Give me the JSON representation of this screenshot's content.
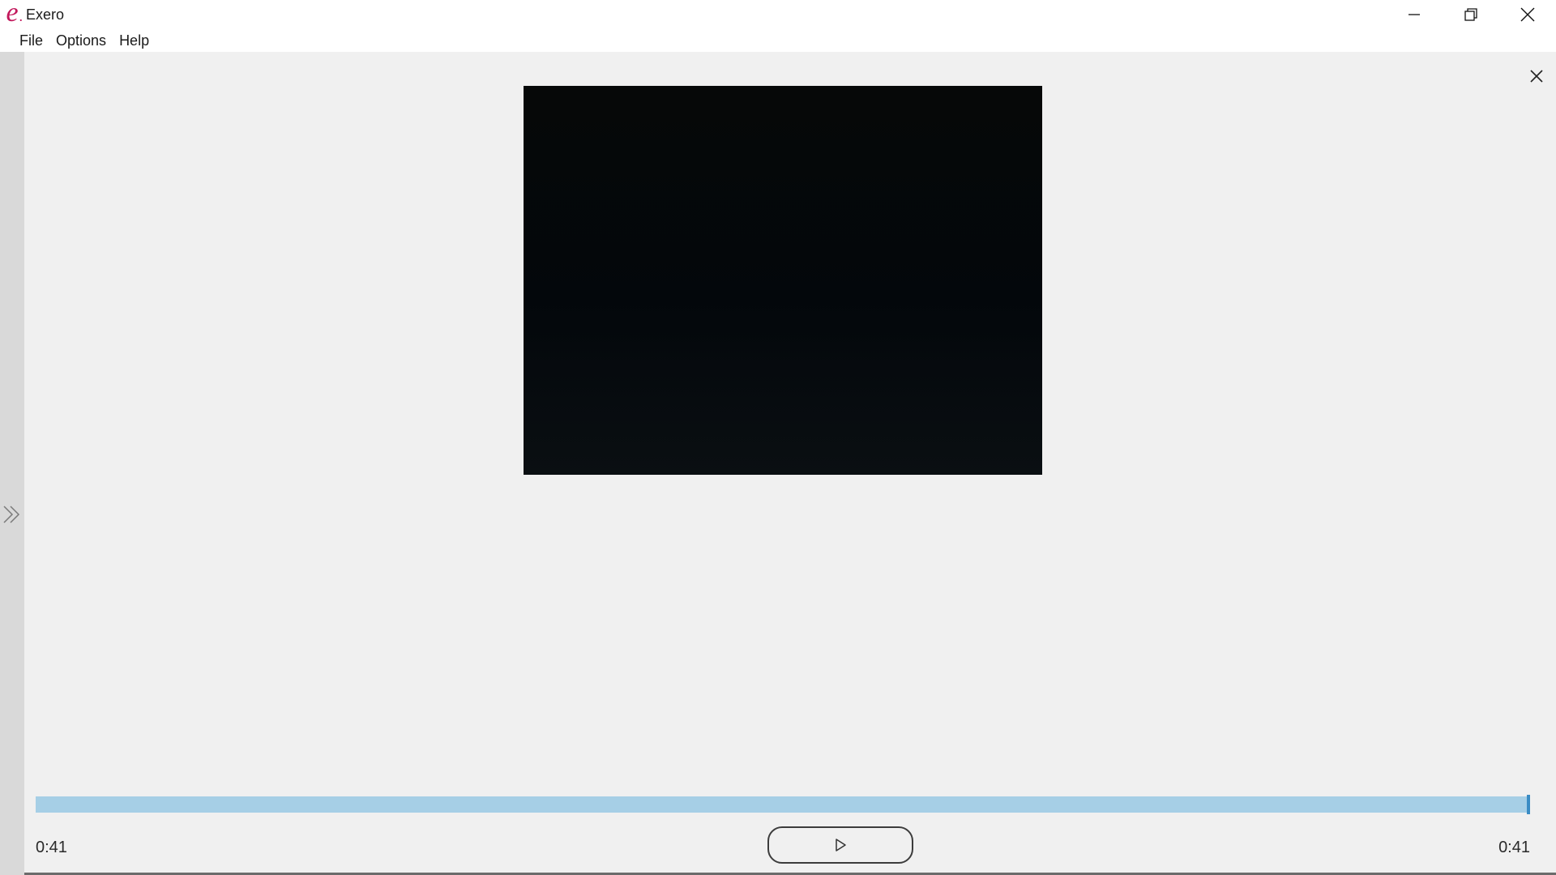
{
  "app": {
    "logo_letter": "e",
    "title": "Exero"
  },
  "menu": {
    "items": [
      "File",
      "Options",
      "Help"
    ]
  },
  "player": {
    "elapsed": "0:41",
    "duration": "0:41",
    "progress": 1.0
  },
  "icons": {
    "minimize": "minimize-icon",
    "restore": "restore-icon",
    "close": "close-icon",
    "expand_panel": "double-chevron-right-icon",
    "pane_close": "close-icon",
    "play": "play-icon"
  },
  "colors": {
    "logo": "#c2185b",
    "seek_track": "#a6cfe6",
    "seek_thumb": "#3a8cc4",
    "video_bg": "#04080b"
  }
}
